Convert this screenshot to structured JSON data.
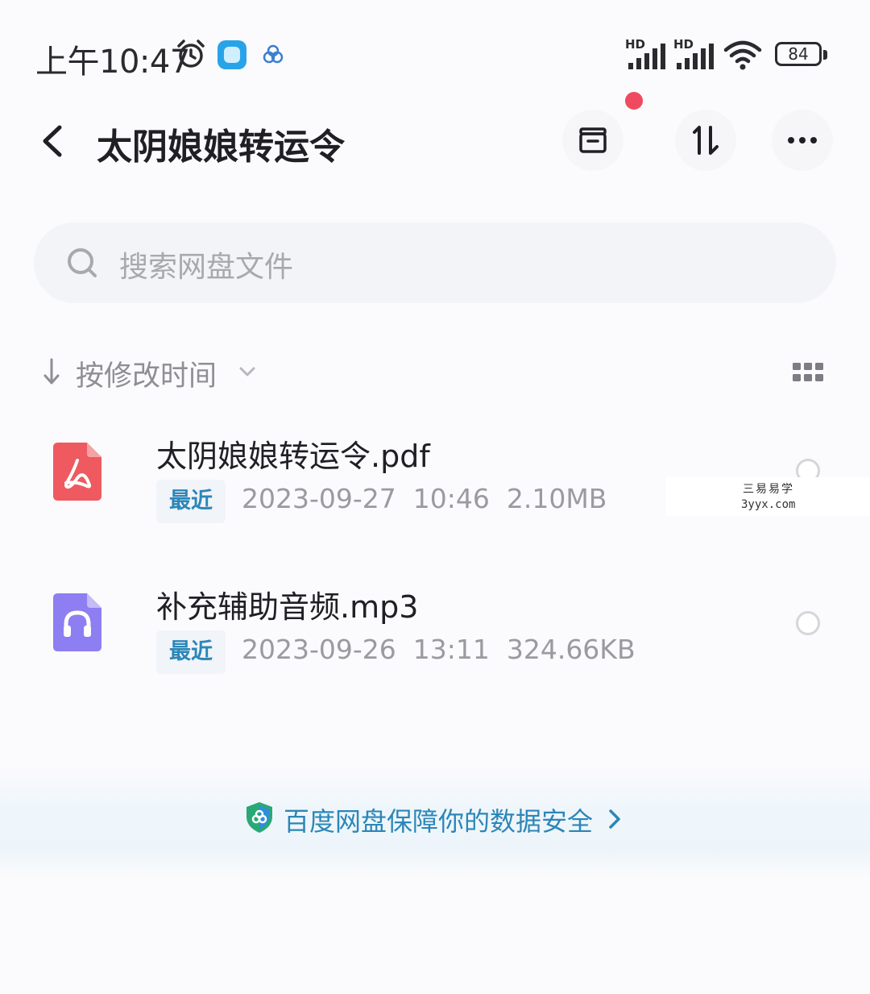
{
  "status_bar": {
    "time": "上午10:47",
    "hd_label": "HD",
    "battery": "84"
  },
  "header": {
    "title": "太阴娘娘转运令"
  },
  "search": {
    "placeholder": "搜索网盘文件"
  },
  "sort": {
    "label": "按修改时间"
  },
  "files": [
    {
      "name": "太阴娘娘转运令.pdf",
      "badge": "最近",
      "meta": "2023-09-27  10:46  2.10MB",
      "icon": "pdf-file-icon",
      "icon_color": "#ee5a5f"
    },
    {
      "name": "补充辅助音频.mp3",
      "badge": "最近",
      "meta": "2023-09-26  13:11  324.66KB",
      "icon": "audio-file-icon",
      "icon_color": "#8d7ef2"
    }
  ],
  "watermark": {
    "line1": "三易易学",
    "line2": "3yyx.com"
  },
  "footer": {
    "security_text": "百度网盘保障你的数据安全"
  },
  "colors": {
    "accent": "#2c86b8",
    "notification_dot": "#ef4a5f"
  }
}
